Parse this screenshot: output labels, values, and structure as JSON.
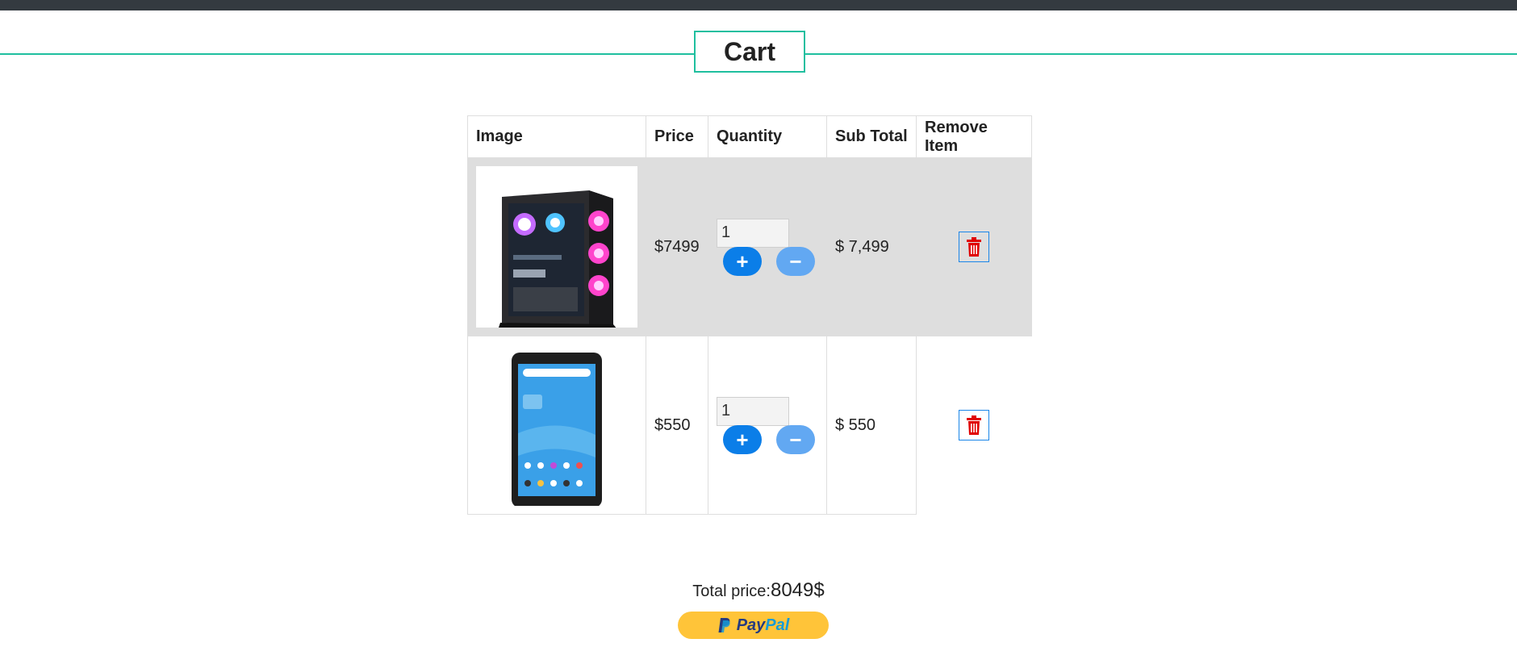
{
  "page": {
    "title": "Cart"
  },
  "table": {
    "headers": [
      "Image",
      "Price",
      "Quantity",
      "Sub Total",
      "Remove Item"
    ],
    "rows": [
      {
        "product": "Gaming PC tower",
        "price": "$7499",
        "quantity": "1",
        "subtotal": "$ 7,499"
      },
      {
        "product": "Android tablet",
        "price": "$550",
        "quantity": "1",
        "subtotal": "$ 550"
      }
    ]
  },
  "buttons": {
    "plus": "+",
    "minus": "−"
  },
  "total": {
    "label": "Total price:",
    "amount": "8049$"
  },
  "paypal": {
    "pay": "Pay",
    "pal": "Pal"
  },
  "colors": {
    "accent": "#1fbf9f",
    "topbar": "#343a40",
    "plus": "#0b7ee8",
    "minus": "#62a8f2",
    "trash": "#e00000",
    "paypal": "#ffc439"
  },
  "icons": [
    "paypal-logo-icon",
    "trash-icon",
    "plus-icon",
    "minus-icon"
  ]
}
